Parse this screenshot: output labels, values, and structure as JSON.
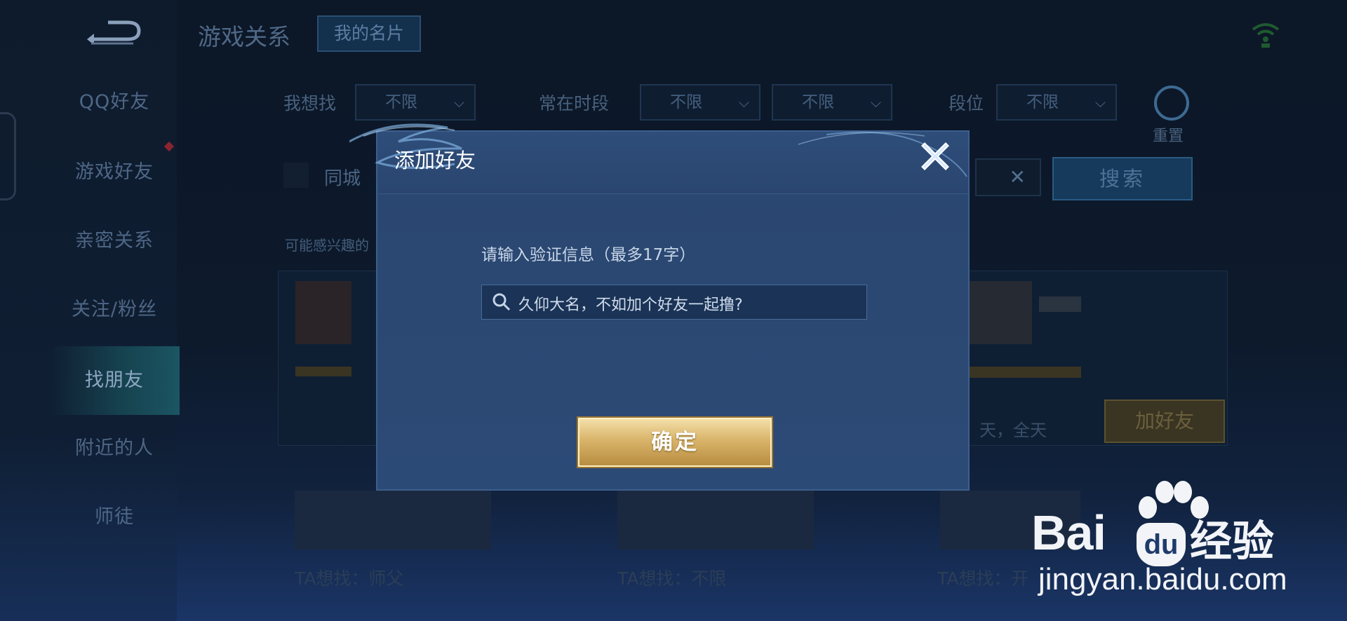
{
  "nav": {
    "items": [
      {
        "label": "QQ好友"
      },
      {
        "label": "游戏好友"
      },
      {
        "label": "亲密关系"
      },
      {
        "label": "关注/粉丝"
      },
      {
        "label": "找朋友"
      },
      {
        "label": "附近的人"
      },
      {
        "label": "师徒"
      }
    ],
    "active_index": 4
  },
  "header": {
    "title": "游戏关系",
    "card_button": "我的名片"
  },
  "filters": {
    "want_label": "我想找",
    "want_value": "不限",
    "time_label": "常在时段",
    "time_value_1": "不限",
    "time_value_2": "不限",
    "rank_label": "段位",
    "rank_value": "不限",
    "reset_label": "重置"
  },
  "search_row": {
    "city_label": "同城",
    "clear_symbol": "✕",
    "search_button": "搜索"
  },
  "section_label": "可能感兴趣的",
  "cards": {
    "add_button": "加好友",
    "time_text": "天，全天",
    "ta_1": "TA想找：师父",
    "ta_2": "TA想找：不限",
    "ta_3": "TA想找：开"
  },
  "dialog": {
    "title": "添加好友",
    "prompt": "请输入验证信息（最多17字）",
    "input_value": "久仰大名，不如加个好友一起撸?",
    "confirm": "确定"
  },
  "watermark": {
    "bai": "Bai",
    "du": "du",
    "jingyan": "经验",
    "url": "jingyan.baidu.com"
  },
  "colors": {
    "dialog_bg": "#2b4872",
    "confirm_gold": "#d9b46a",
    "text_dim": "#4e6786"
  }
}
